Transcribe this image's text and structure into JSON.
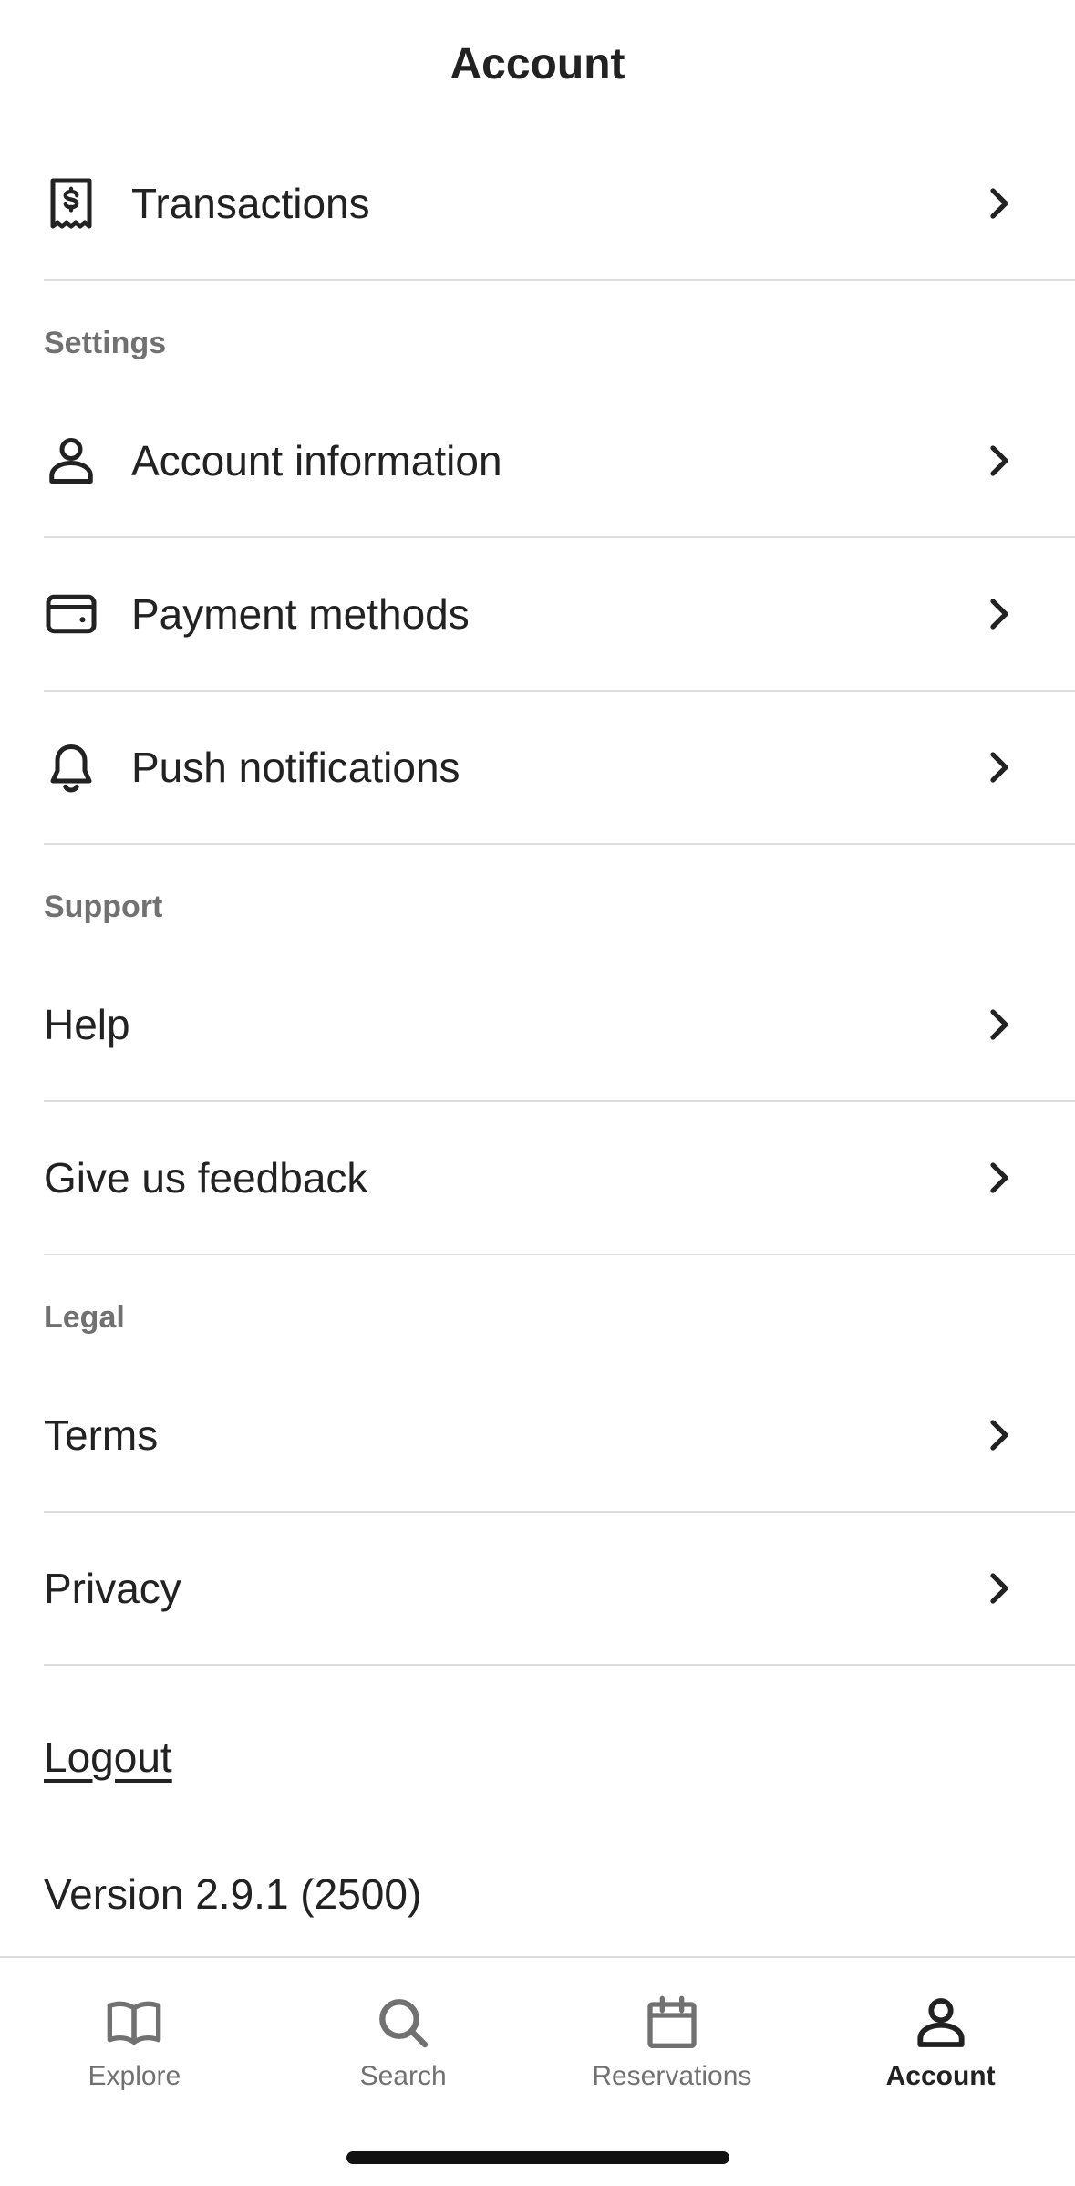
{
  "header": {
    "title": "Account"
  },
  "top_rows": [
    {
      "label": "Transactions",
      "icon": "receipt-dollar-icon"
    }
  ],
  "sections": [
    {
      "title": "Settings",
      "items": [
        {
          "label": "Account information",
          "icon": "person-icon"
        },
        {
          "label": "Payment methods",
          "icon": "credit-card-icon"
        },
        {
          "label": "Push notifications",
          "icon": "bell-icon"
        }
      ]
    },
    {
      "title": "Support",
      "items": [
        {
          "label": "Help"
        },
        {
          "label": "Give us feedback"
        }
      ]
    },
    {
      "title": "Legal",
      "items": [
        {
          "label": "Terms"
        },
        {
          "label": "Privacy"
        }
      ]
    }
  ],
  "logout_label": "Logout",
  "version_text": "Version 2.9.1 (2500)",
  "tabbar": {
    "tabs": [
      {
        "label": "Explore",
        "icon": "book-open-icon"
      },
      {
        "label": "Search",
        "icon": "search-icon"
      },
      {
        "label": "Reservations",
        "icon": "calendar-icon"
      },
      {
        "label": "Account",
        "icon": "person-icon"
      }
    ],
    "active": "Account"
  },
  "colors": {
    "text": "#222222",
    "muted": "#717171",
    "divider": "#dddddd"
  }
}
